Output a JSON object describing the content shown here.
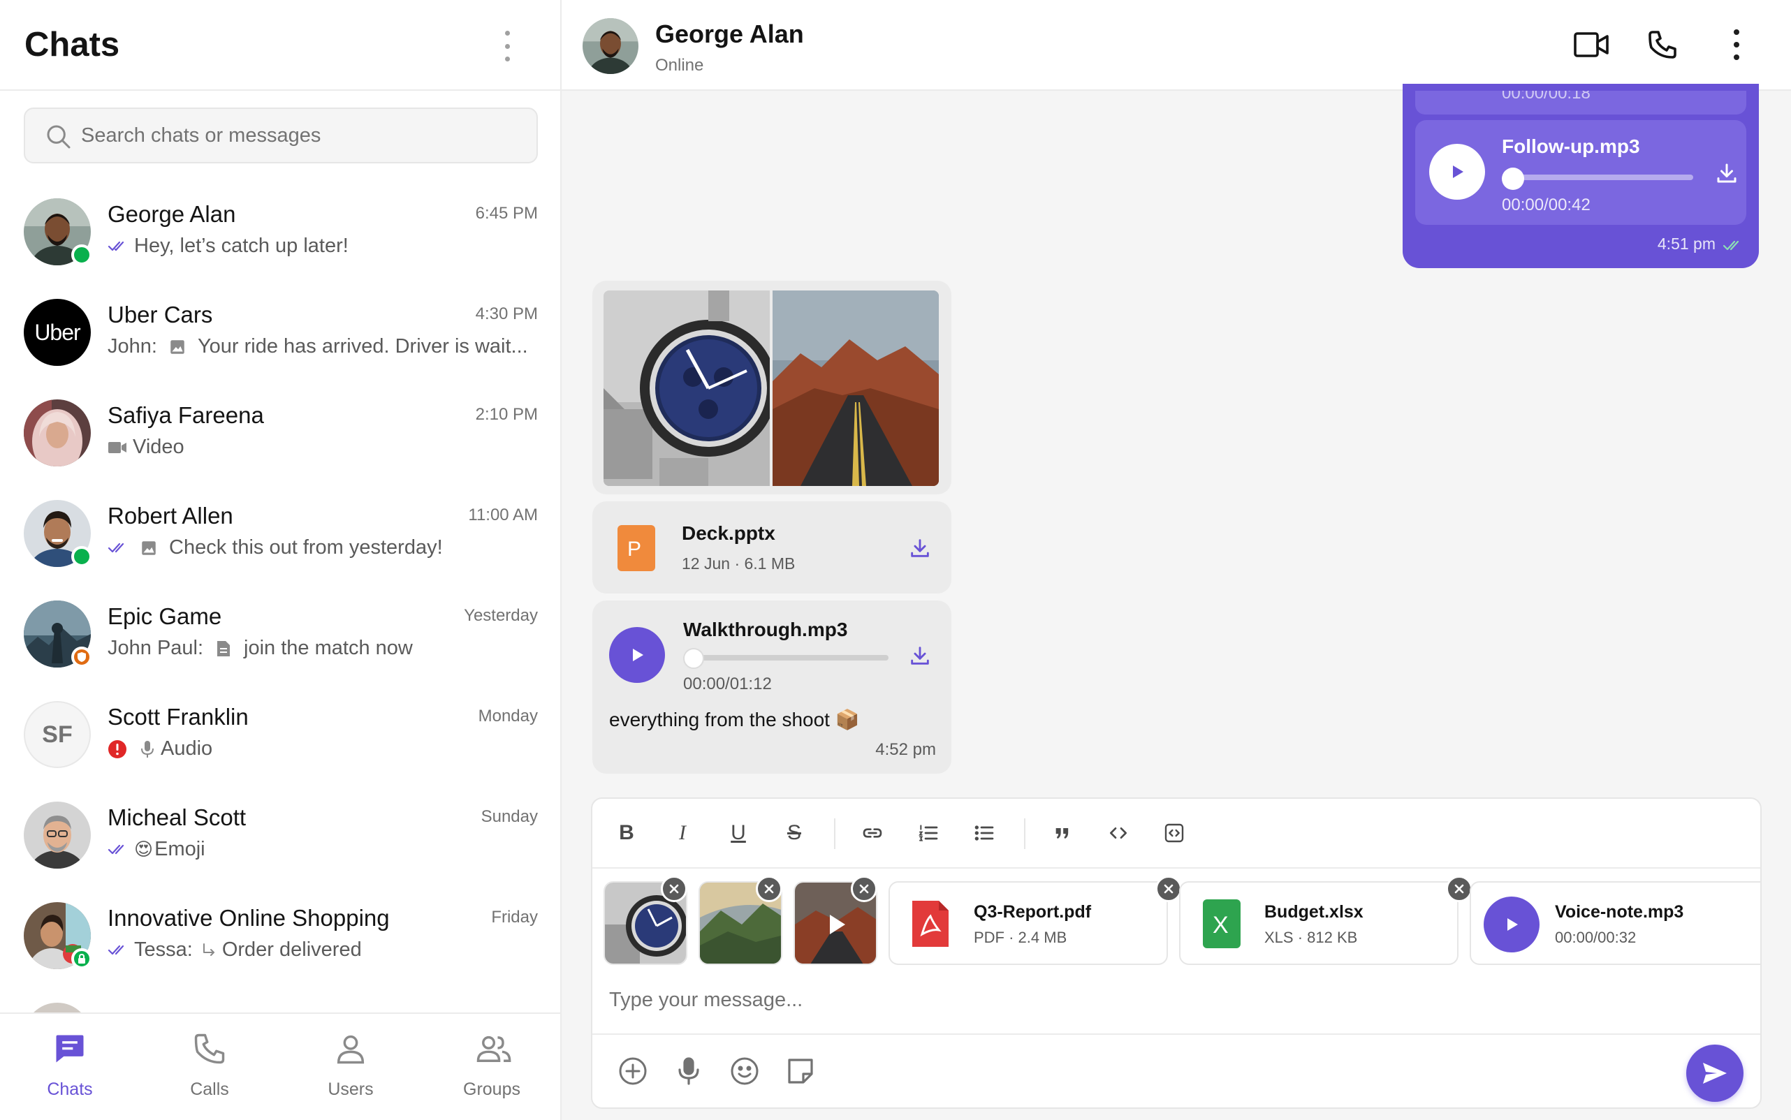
{
  "sidebar": {
    "title": "Chats",
    "search_placeholder": "Search chats or messages",
    "chats": [
      {
        "name": "George Alan",
        "time": "6:45 PM",
        "preview": "Hey, let’s catch up later!"
      },
      {
        "name": "Uber Cars",
        "time": "4:30 PM",
        "sender": "John:",
        "preview": "Your ride has arrived. Driver is wait..."
      },
      {
        "name": "Safiya Fareena",
        "time": "2:10 PM",
        "preview": "Video"
      },
      {
        "name": "Robert Allen",
        "time": "11:00 AM",
        "preview": "Check this out from yesterday!"
      },
      {
        "name": "Epic Game",
        "time": "Yesterday",
        "sender": "John Paul:",
        "preview": "join the match now"
      },
      {
        "name": "Scott Franklin",
        "time": "Monday",
        "preview": "Audio",
        "initials": "SF"
      },
      {
        "name": "Micheal Scott",
        "time": "Sunday",
        "preview": "Emoji",
        "emoji": "😍"
      },
      {
        "name": "Innovative Online Shopping",
        "time": "Friday",
        "sender": "Tessa:",
        "preview": "Order delivered"
      }
    ],
    "uber_logo_text": "Uber",
    "nav": [
      {
        "label": "Chats",
        "icon": "chat-icon",
        "active": true
      },
      {
        "label": "Calls",
        "icon": "phone-icon",
        "active": false
      },
      {
        "label": "Users",
        "icon": "user-icon",
        "active": false
      },
      {
        "label": "Groups",
        "icon": "group-icon",
        "active": false
      }
    ]
  },
  "conversation": {
    "contact_name": "George Alan",
    "contact_status": "Online",
    "outgoing": {
      "prev_duration": "00:00/00:18",
      "audio_name": "Follow-up.mp3",
      "audio_duration": "00:00/00:42",
      "time": "4:51 pm"
    },
    "incoming": {
      "file_name": "Deck.pptx",
      "file_meta": "12 Jun · 6.1 MB",
      "file_letter": "P",
      "audio_name": "Walkthrough.mp3",
      "audio_duration": "00:00/01:12",
      "caption": "everything from the shoot 📦",
      "time": "4:52 pm"
    }
  },
  "composer": {
    "toolbar": [
      "B",
      "I",
      "U",
      "S"
    ],
    "attachments": [
      {
        "name": "Q3-Report.pdf",
        "meta": "PDF · 2.4 MB"
      },
      {
        "name": "Budget.xlsx",
        "meta": "XLS · 812 KB",
        "letter": "X"
      },
      {
        "name": "Voice-note.mp3",
        "meta": "00:00/00:32"
      }
    ],
    "placeholder": "Type your message..."
  },
  "colors": {
    "accent": "#6852d6",
    "online": "#09b04d",
    "error": "#e02727"
  }
}
